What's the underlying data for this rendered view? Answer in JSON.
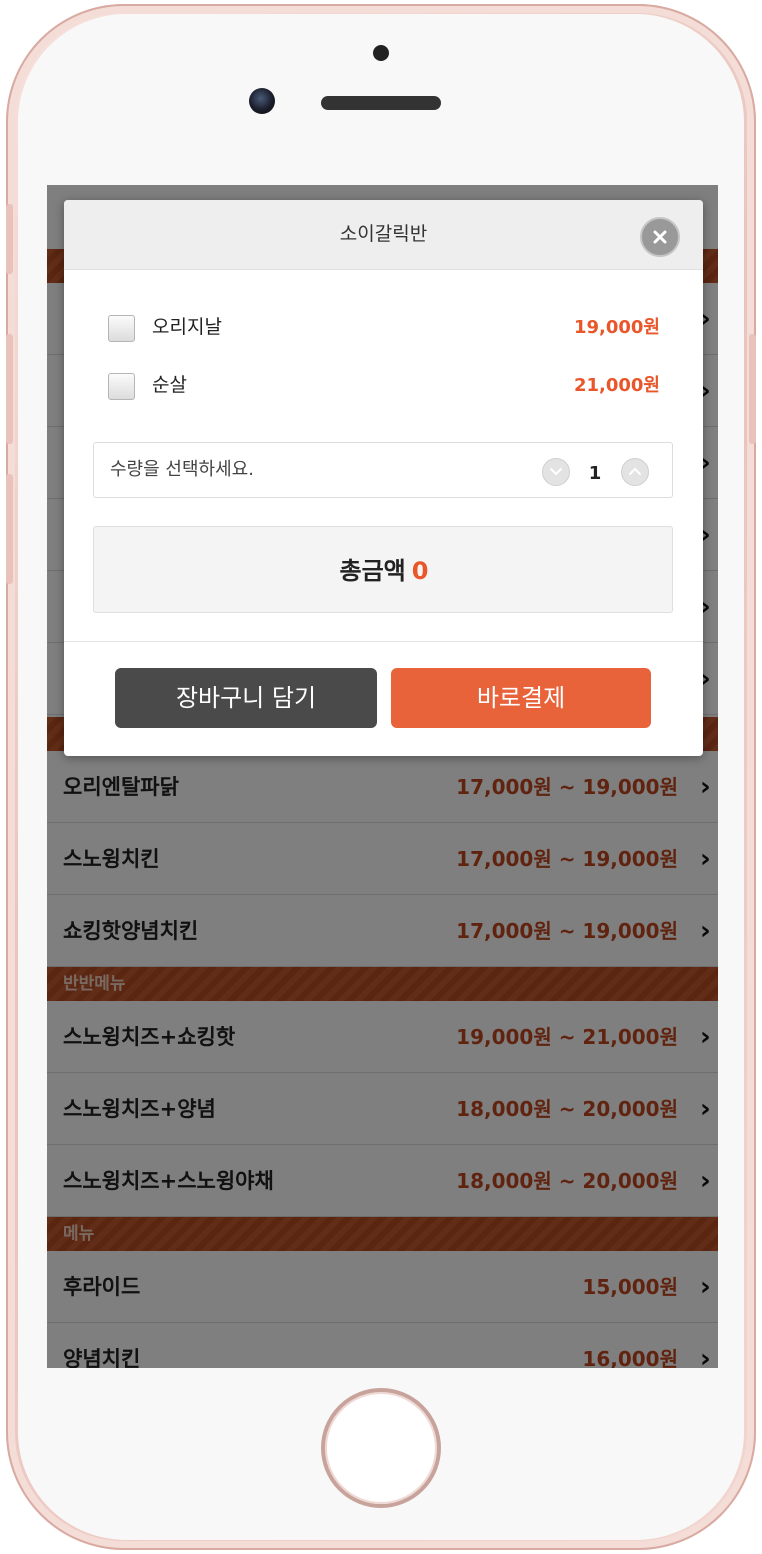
{
  "modal": {
    "title": "소이갈릭반",
    "options": [
      {
        "label": "오리지날",
        "price": "19,000원"
      },
      {
        "label": "순살",
        "price": "21,000원"
      }
    ],
    "quantity": {
      "label": "수량을 선택하세요.",
      "value": "1"
    },
    "total": {
      "label": "총금액",
      "value": "0"
    },
    "buttons": {
      "cart": "장바구니 담기",
      "buy": "바로결제"
    }
  },
  "menu": {
    "group1_rows": [
      {
        "name": "오리엔탈파닭",
        "price": "17,000원 ~ 19,000원"
      },
      {
        "name": "스노윙치킨",
        "price": "17,000원 ~ 19,000원"
      },
      {
        "name": "쇼킹핫양념치킨",
        "price": "17,000원 ~ 19,000원"
      }
    ],
    "section_half": "반반메뉴",
    "half_rows": [
      {
        "name": "스노윙치즈+쇼킹핫",
        "price": "19,000원 ~ 21,000원"
      },
      {
        "name": "스노윙치즈+양념",
        "price": "18,000원 ~ 20,000원"
      },
      {
        "name": "스노윙치즈+스노윙야채",
        "price": "18,000원 ~ 20,000원"
      }
    ],
    "section_menu": "메뉴",
    "menu_rows": [
      {
        "name": "후라이드",
        "price": "15,000원"
      },
      {
        "name": "양념치킨",
        "price": "16,000원"
      }
    ]
  },
  "colors": {
    "accent": "#e8623a",
    "price": "#e8562a",
    "cart_button": "#4a4a4a",
    "section_bar": "#c45a2e"
  },
  "icons": {
    "close": "close-icon",
    "row_arrow": "chevron-right-icon",
    "qty_down": "chevron-down-icon",
    "qty_up": "chevron-up-icon"
  }
}
